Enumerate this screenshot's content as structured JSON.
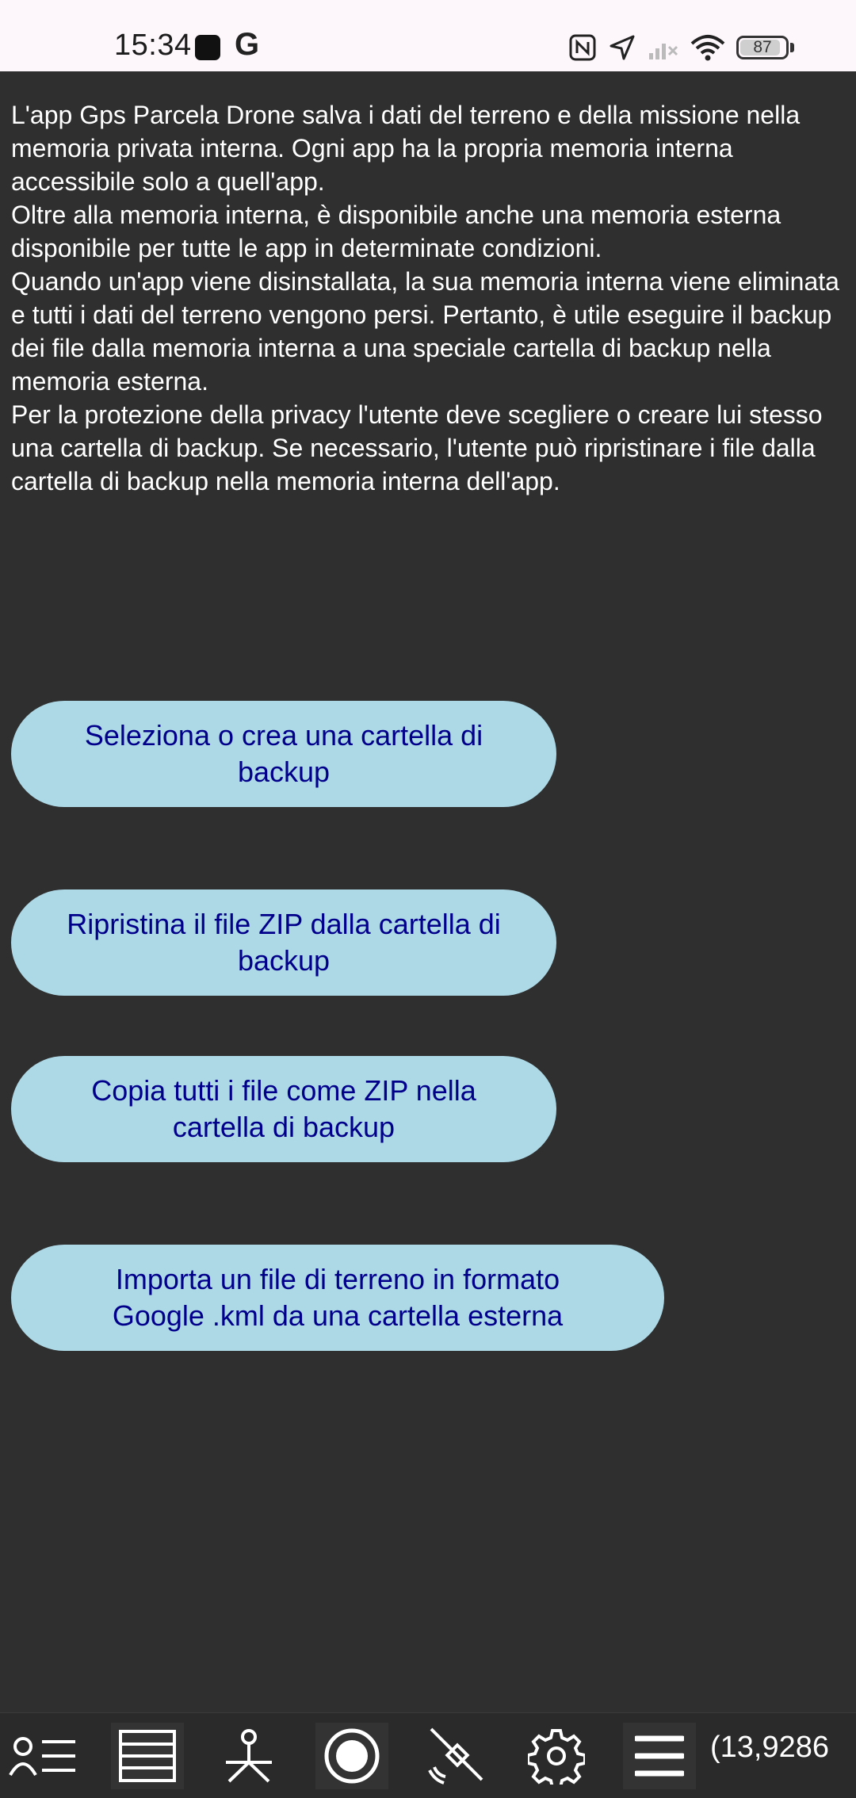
{
  "status_bar": {
    "time": "15:34",
    "g_letter": "G",
    "battery_level": "87"
  },
  "info_text": "L'app Gps Parcela Drone salva i dati del terreno e della missione nella memoria privata interna. Ogni app ha la propria memoria interna accessibile solo a quell'app.\nOltre alla memoria interna, è disponibile anche una memoria esterna disponibile per tutte le app in determinate condizioni.\nQuando un'app viene disinstallata, la sua memoria interna viene eliminata e tutti i dati del terreno vengono persi. Pertanto, è utile eseguire il backup dei file dalla memoria interna a una speciale cartella di backup nella memoria esterna.\nPer la protezione della privacy l'utente deve scegliere o creare lui stesso una cartella di backup. Se necessario, l'utente può ripristinare i file dalla cartella di backup nella memoria interna dell'app.",
  "buttons": {
    "select_folder": "Seleziona o crea una cartella di\nbackup",
    "restore_zip": "Ripristina il file ZIP dalla cartella di\nbackup",
    "copy_zip": "Copia tutti i file come ZIP nella\ncartella di backup",
    "import_kml": "Importa un file di terreno in formato\nGoogle .kml da una cartella esterna"
  },
  "bottom_bar": {
    "icons": [
      "user-list-icon",
      "list-icon",
      "survey-tripod-icon",
      "record-icon",
      "gps-off-icon",
      "settings-icon",
      "menu-icon"
    ],
    "coords": "(13,9286"
  }
}
